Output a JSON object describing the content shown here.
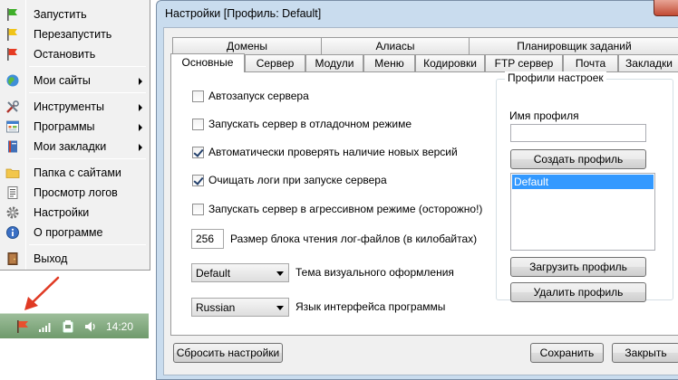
{
  "menu": {
    "items": [
      {
        "label": "Запустить",
        "icon": "green-flag-icon",
        "has_submenu": false
      },
      {
        "label": "Перезапустить",
        "icon": "yellow-flag-icon",
        "has_submenu": false
      },
      {
        "label": "Остановить",
        "icon": "red-flag-icon",
        "has_submenu": false
      },
      {
        "label": "Мои сайты",
        "icon": "globe-icon",
        "has_submenu": true
      },
      {
        "label": "Инструменты",
        "icon": "tools-icon",
        "has_submenu": true
      },
      {
        "label": "Программы",
        "icon": "programs-icon",
        "has_submenu": true
      },
      {
        "label": "Мои закладки",
        "icon": "bookmarks-icon",
        "has_submenu": true
      },
      {
        "label": "Папка с сайтами",
        "icon": "folder-icon",
        "has_submenu": false
      },
      {
        "label": "Просмотр логов",
        "icon": "log-icon",
        "has_submenu": false
      },
      {
        "label": "Настройки",
        "icon": "gear-icon",
        "has_submenu": false
      },
      {
        "label": "О программе",
        "icon": "info-icon",
        "has_submenu": false
      },
      {
        "label": "Выход",
        "icon": "exit-door-icon",
        "has_submenu": false
      }
    ]
  },
  "taskbar": {
    "clock": "14:20",
    "icons": [
      "red-flag-tray-icon",
      "signal-bars-icon",
      "device-icon",
      "volume-icon"
    ]
  },
  "dialog": {
    "title": "Настройки [Профиль: Default]",
    "tabs_back": [
      "Домены",
      "Алиасы",
      "Планировщик заданий"
    ],
    "tabs_front": [
      "Основные",
      "Сервер",
      "Модули",
      "Меню",
      "Кодировки",
      "FTP сервер",
      "Почта",
      "Закладки"
    ],
    "active_tab": "Основные",
    "checkboxes": [
      {
        "label": "Автозапуск сервера",
        "checked": false
      },
      {
        "label": "Запускать сервер в отладочном режиме",
        "checked": false
      },
      {
        "label": "Автоматически проверять наличие новых версий",
        "checked": true
      },
      {
        "label": "Очищать логи при запуске сервера",
        "checked": true
      },
      {
        "label": "Запускать сервер в агрессивном режиме (осторожно!)",
        "checked": false
      }
    ],
    "log_block": {
      "value": "256",
      "label": "Размер блока чтения лог-файлов (в килобайтах)"
    },
    "theme": {
      "value": "Default",
      "label": "Тема визуального оформления"
    },
    "language": {
      "value": "Russian",
      "label": "Язык интерфейса программы"
    },
    "profiles": {
      "legend": "Профили настроек",
      "name_label": "Имя профиля",
      "name_value": "",
      "create_btn": "Создать профиль",
      "list": [
        "Default"
      ],
      "selected": "Default",
      "load_btn": "Загрузить профиль",
      "delete_btn": "Удалить профиль"
    },
    "reset_btn": "Сбросить настройки",
    "save_btn": "Сохранить",
    "close_btn": "Закрыть"
  },
  "colors": {
    "accent_red": "#e63b23",
    "selection": "#3399ff",
    "window_frame": "#c9dcee"
  }
}
